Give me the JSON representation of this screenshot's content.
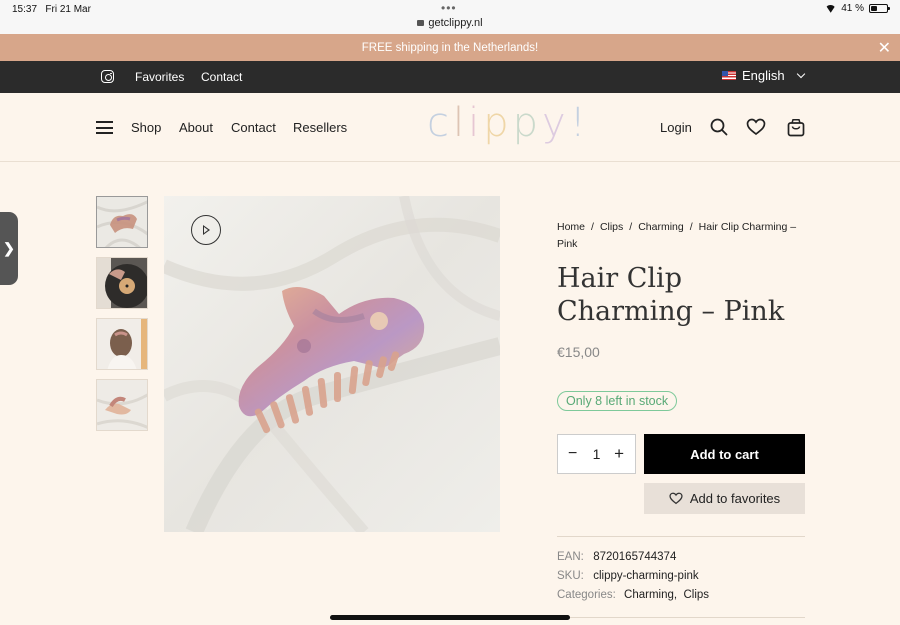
{
  "status_bar": {
    "time": "15:37",
    "date": "Fri 21 Mar",
    "url": "getclippy.nl",
    "battery": "41 %",
    "battery_level": 0.41
  },
  "promo": {
    "text": "FREE shipping in the Netherlands!",
    "close_glyph": "✕"
  },
  "topbar": {
    "links": [
      "Favorites",
      "Contact"
    ],
    "language": "English",
    "icons": [
      "instagram-icon",
      "us-flag-icon",
      "chevron-down-icon"
    ]
  },
  "header": {
    "nav": [
      "Shop",
      "About",
      "Contact",
      "Resellers"
    ],
    "logo": "clippy!",
    "logo_colors": [
      "#9fb8d9",
      "#c9a58f",
      "#d7a7c2",
      "#e6c27a",
      "#a9c7b6",
      "#c8b0d9",
      "#9fb8d9"
    ],
    "login": "Login",
    "icons": [
      "menu-icon",
      "search-icon",
      "heart-icon",
      "cart-icon"
    ]
  },
  "side_tab": {
    "glyph": "❯"
  },
  "gallery": {
    "thumbnails": [
      "hair-clip-on-fabric",
      "clip-on-vinyl-record",
      "clip-in-hair",
      "clip-in-hand"
    ],
    "active_index": 0,
    "play_icon": "play-icon"
  },
  "product": {
    "breadcrumb": [
      "Home",
      "Clips",
      "Charming",
      "Hair Clip Charming – Pink"
    ],
    "breadcrumb_sep": "/",
    "title": "Hair Clip Charming – Pink",
    "price": "€15,00",
    "stock": "Only 8 left in stock",
    "quantity": "1",
    "minus": "−",
    "plus": "+",
    "add_to_cart": "Add to cart",
    "add_to_favorites": "Add to favorites",
    "ean_label": "EAN:",
    "ean": "8720165744374",
    "sku_label": "SKU:",
    "sku": "clippy-charming-pink",
    "categories_label": "Categories:",
    "categories": [
      "Charming",
      "Clips"
    ]
  },
  "colors": {
    "promo_bg": "#d7a68a",
    "topbar_bg": "#2b2b2b",
    "page_bg": "#fdf5ec",
    "stock_green": "#58a976",
    "button_black": "#000000"
  }
}
